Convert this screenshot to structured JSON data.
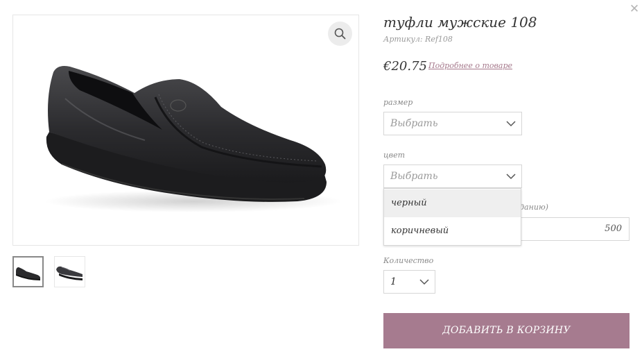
{
  "modal": {
    "close_icon": "close-icon",
    "close_glyph": "✕"
  },
  "gallery": {
    "zoom_icon": "zoom-icon",
    "main_image": "black-leather-loafer",
    "thumbnails": [
      "black-loafer-side",
      "black-loafer-pair"
    ]
  },
  "product": {
    "title": "туфли мужские 108",
    "sku": "Артикул: Ref108",
    "price": "€20.75",
    "details_link": "Подробнее о товаре"
  },
  "options": {
    "size": {
      "label": "размер",
      "value": "Выбрать"
    },
    "color": {
      "label": "цвет",
      "value": "Выбрать",
      "options": [
        "черный",
        "коричневый"
      ],
      "highlighted_index": 0
    },
    "custom_price": {
      "label_tail": "кеданию)",
      "value": "500"
    },
    "quantity": {
      "label": "Количество",
      "value": "1"
    }
  },
  "cart": {
    "add_label": "ДОБАВИТЬ В КОРЗИНУ"
  },
  "colors": {
    "accent": "#a67b8f",
    "link": "#a5788b",
    "border": "#d6d6d6",
    "highlight": "#efefef"
  }
}
